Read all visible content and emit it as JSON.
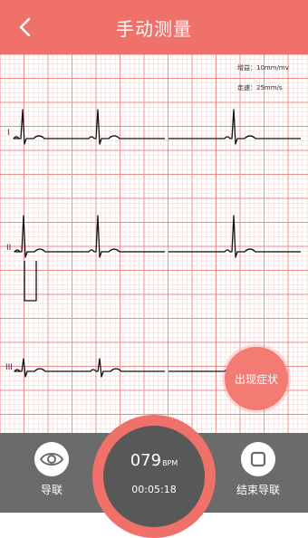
{
  "header": {
    "title": "手动测量",
    "back_icon": "chevron-left-icon"
  },
  "ecg": {
    "gain_label": "增益：10mm/mv",
    "speed_label": "走速：25mm/s",
    "leads": [
      "I",
      "II",
      "III"
    ]
  },
  "symptom_button": {
    "label": "出现症状"
  },
  "bottom": {
    "lead_button": {
      "label": "导联",
      "icon": "eye-icon"
    },
    "stop_button": {
      "label": "结束导联",
      "icon": "stop-icon"
    },
    "heart_rate": {
      "value": "079",
      "unit": "BPM"
    },
    "timer": "00:05:18"
  },
  "colors": {
    "accent": "#f0716a",
    "grid_minor": "#f6c4c1",
    "grid_major": "#ee8d88",
    "bottom_bar": "#6b6b6b"
  }
}
